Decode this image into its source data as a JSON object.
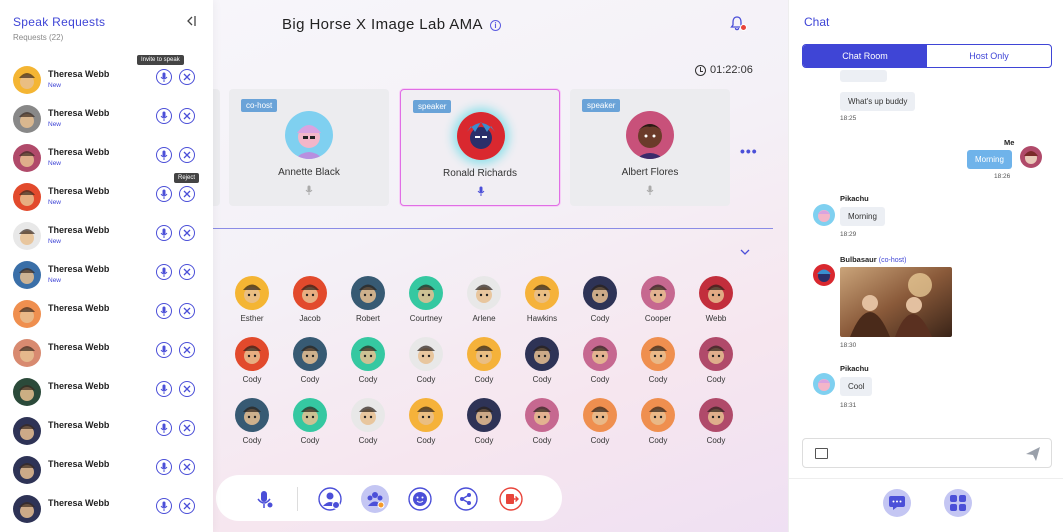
{
  "header": {
    "title": "Big Horse X Image Lab AMA",
    "info_icon": "info-icon",
    "bell_icon": "bell-icon",
    "timer": "01:22:06"
  },
  "speakers": [
    {
      "role": "co-host",
      "name": "Annette Black",
      "color": "#7fd0f0"
    },
    {
      "role": "speaker",
      "name": "Ronald Richards",
      "color": "#d9282f",
      "active": true
    },
    {
      "role": "speaker",
      "name": "Albert Flores",
      "color": "#c8517a"
    }
  ],
  "audience": [
    [
      {
        "name": "Esther",
        "color": "#f4b533"
      },
      {
        "name": "Jacob",
        "color": "#e24a2c"
      },
      {
        "name": "Robert",
        "color": "#375a73"
      },
      {
        "name": "Courtney",
        "color": "#35c8a1"
      },
      {
        "name": "Arlene",
        "color": "#e8e8e8"
      },
      {
        "name": "Hawkins",
        "color": "#f5b23a"
      },
      {
        "name": "Cody",
        "color": "#2e3356"
      },
      {
        "name": "Cooper",
        "color": "#c66890"
      },
      {
        "name": "Webb",
        "color": "#c22e3c"
      }
    ],
    [
      {
        "name": "Cody",
        "color": "#e24a2c"
      },
      {
        "name": "Cody",
        "color": "#375a73"
      },
      {
        "name": "Cody",
        "color": "#35c8a1"
      },
      {
        "name": "Cody",
        "color": "#e8e8e8"
      },
      {
        "name": "Cody",
        "color": "#f5b23a"
      },
      {
        "name": "Cody",
        "color": "#2e3356"
      },
      {
        "name": "Cody",
        "color": "#c66890"
      },
      {
        "name": "Cody",
        "color": "#ef8f4f"
      },
      {
        "name": "Cody",
        "color": "#b04a6a"
      }
    ],
    [
      {
        "name": "Cody",
        "color": "#375a73"
      },
      {
        "name": "Cody",
        "color": "#35c8a1"
      },
      {
        "name": "Cody",
        "color": "#e8e8e8"
      },
      {
        "name": "Cody",
        "color": "#f5b23a"
      },
      {
        "name": "Cody",
        "color": "#2e3356"
      },
      {
        "name": "Cody",
        "color": "#c66890"
      },
      {
        "name": "Cody",
        "color": "#ef8f4f"
      },
      {
        "name": "Cody",
        "color": "#ef8f4f"
      },
      {
        "name": "Cody",
        "color": "#b04a6a"
      }
    ]
  ],
  "controls": [
    "mic-icon",
    "user-settings-icon",
    "group-icon",
    "emoji-icon",
    "share-icon",
    "leave-icon"
  ],
  "speak_requests": {
    "title": "Speak Requests",
    "count": "Requests (22)",
    "tooltip_invite": "Invite to speak",
    "tooltip_reject": "Reject",
    "rows": [
      {
        "name": "Theresa Webb",
        "status": "New",
        "color": "#f4b533"
      },
      {
        "name": "Theresa Webb",
        "status": "New",
        "color": "#888"
      },
      {
        "name": "Theresa Webb",
        "status": "New",
        "color": "#b04a6a"
      },
      {
        "name": "Theresa Webb",
        "status": "New",
        "color": "#e24a2c"
      },
      {
        "name": "Theresa Webb",
        "status": "New",
        "color": "#e8e8e8"
      },
      {
        "name": "Theresa Webb",
        "status": "New",
        "color": "#3a6fa8"
      },
      {
        "name": "Theresa Webb",
        "status": "",
        "color": "#ef8f4f"
      },
      {
        "name": "Theresa Webb",
        "status": "",
        "color": "#d88a70"
      },
      {
        "name": "Theresa Webb",
        "status": "",
        "color": "#2b4a3a"
      },
      {
        "name": "Theresa Webb",
        "status": "",
        "color": "#2e3356"
      },
      {
        "name": "Theresa Webb",
        "status": "",
        "color": "#2e3356"
      },
      {
        "name": "Theresa Webb",
        "status": "",
        "color": "#2e3356"
      }
    ]
  },
  "chat": {
    "title": "Chat",
    "tabs": [
      "Chat Room",
      "Host Only"
    ],
    "messages": {
      "m1_text": "What's up buddy",
      "m1_time": "18:25",
      "m2_sender": "Me",
      "m2_text": "Morning",
      "m2_time": "18:26",
      "m3_sender": "Pikachu",
      "m3_text": "Morning",
      "m3_time": "18:29",
      "m4_sender": "Bulbasaur",
      "m4_role": "(co-host)",
      "m4_time": "18:30",
      "m5_sender": "Pikachu",
      "m5_text": "Cool",
      "m5_time": "18:31"
    }
  }
}
